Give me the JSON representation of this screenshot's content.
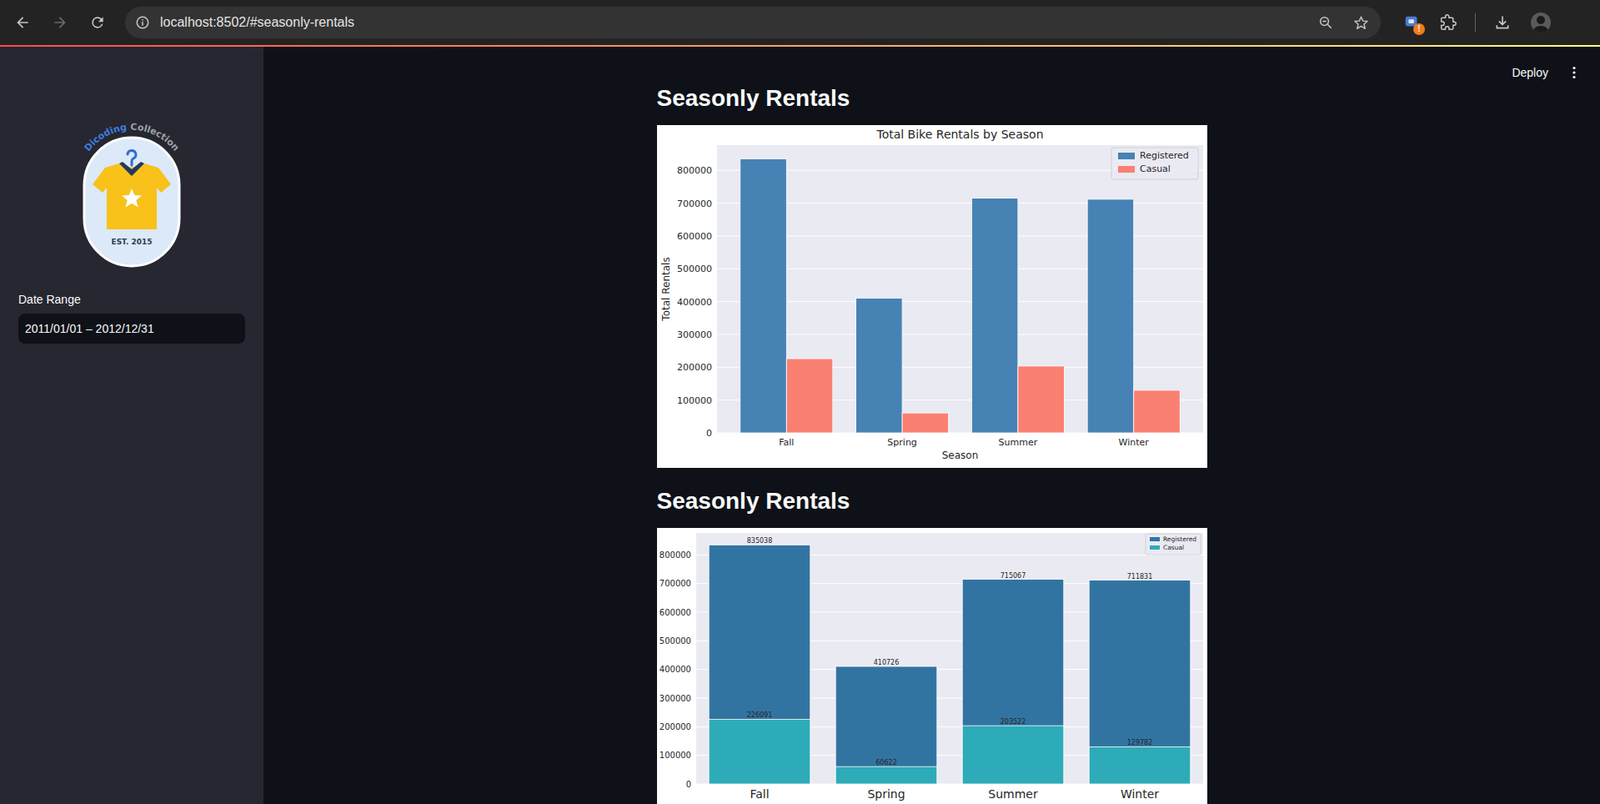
{
  "browser": {
    "url": "localhost:8502/#seasonly-rentals",
    "back_enabled": true,
    "forward_enabled": false,
    "extension_badge": "!"
  },
  "sidebar": {
    "logo": {
      "arc_words": [
        {
          "text": "Dicoding",
          "color": "#3b7fe0"
        },
        {
          "text": "Collection",
          "color": "#9aa0a6"
        }
      ],
      "badge_text": "EST. 2015"
    },
    "date_range": {
      "label": "Date Range",
      "value": "2011/01/01 – 2012/12/31"
    }
  },
  "header": {
    "deploy": "Deploy"
  },
  "sections": [
    {
      "heading": "Seasonly Rentals",
      "chart": {
        "kind": "grouped",
        "title": "Total Bike Rentals by Season",
        "x_label": "Season",
        "y_label": "Total Rentals",
        "categories": [
          "Fall",
          "Spring",
          "Summer",
          "Winter"
        ],
        "y_ticks": [
          "0",
          "100000",
          "200000",
          "300000",
          "400000",
          "500000",
          "600000",
          "700000",
          "800000"
        ],
        "series": [
          {
            "name": "Registered",
            "color": "#4682b4",
            "values": [
              835038,
              410726,
              715067,
              711831
            ]
          },
          {
            "name": "Casual",
            "color": "#fa8072",
            "values": [
              226091,
              60622,
              203522,
              129782
            ]
          }
        ]
      }
    },
    {
      "heading": "Seasonly Rentals",
      "chart": {
        "kind": "overlaid",
        "categories": [
          "Fall",
          "Spring",
          "Summer",
          "Winter"
        ],
        "y_ticks": [
          "0",
          "100000",
          "200000",
          "300000",
          "400000",
          "500000",
          "600000",
          "700000",
          "800000"
        ],
        "series": [
          {
            "name": "Registered",
            "color": "#3274a1",
            "values": [
              835038,
              410726,
              715067,
              711831
            ],
            "labels": [
              "835038",
              "410726",
              "715067",
              "711831"
            ]
          },
          {
            "name": "Casual",
            "color": "#2eabb8",
            "values": [
              226091,
              60622,
              203522,
              129782
            ],
            "labels": [
              "226091",
              "60622",
              "203522",
              "129782"
            ]
          }
        ]
      }
    }
  ]
}
